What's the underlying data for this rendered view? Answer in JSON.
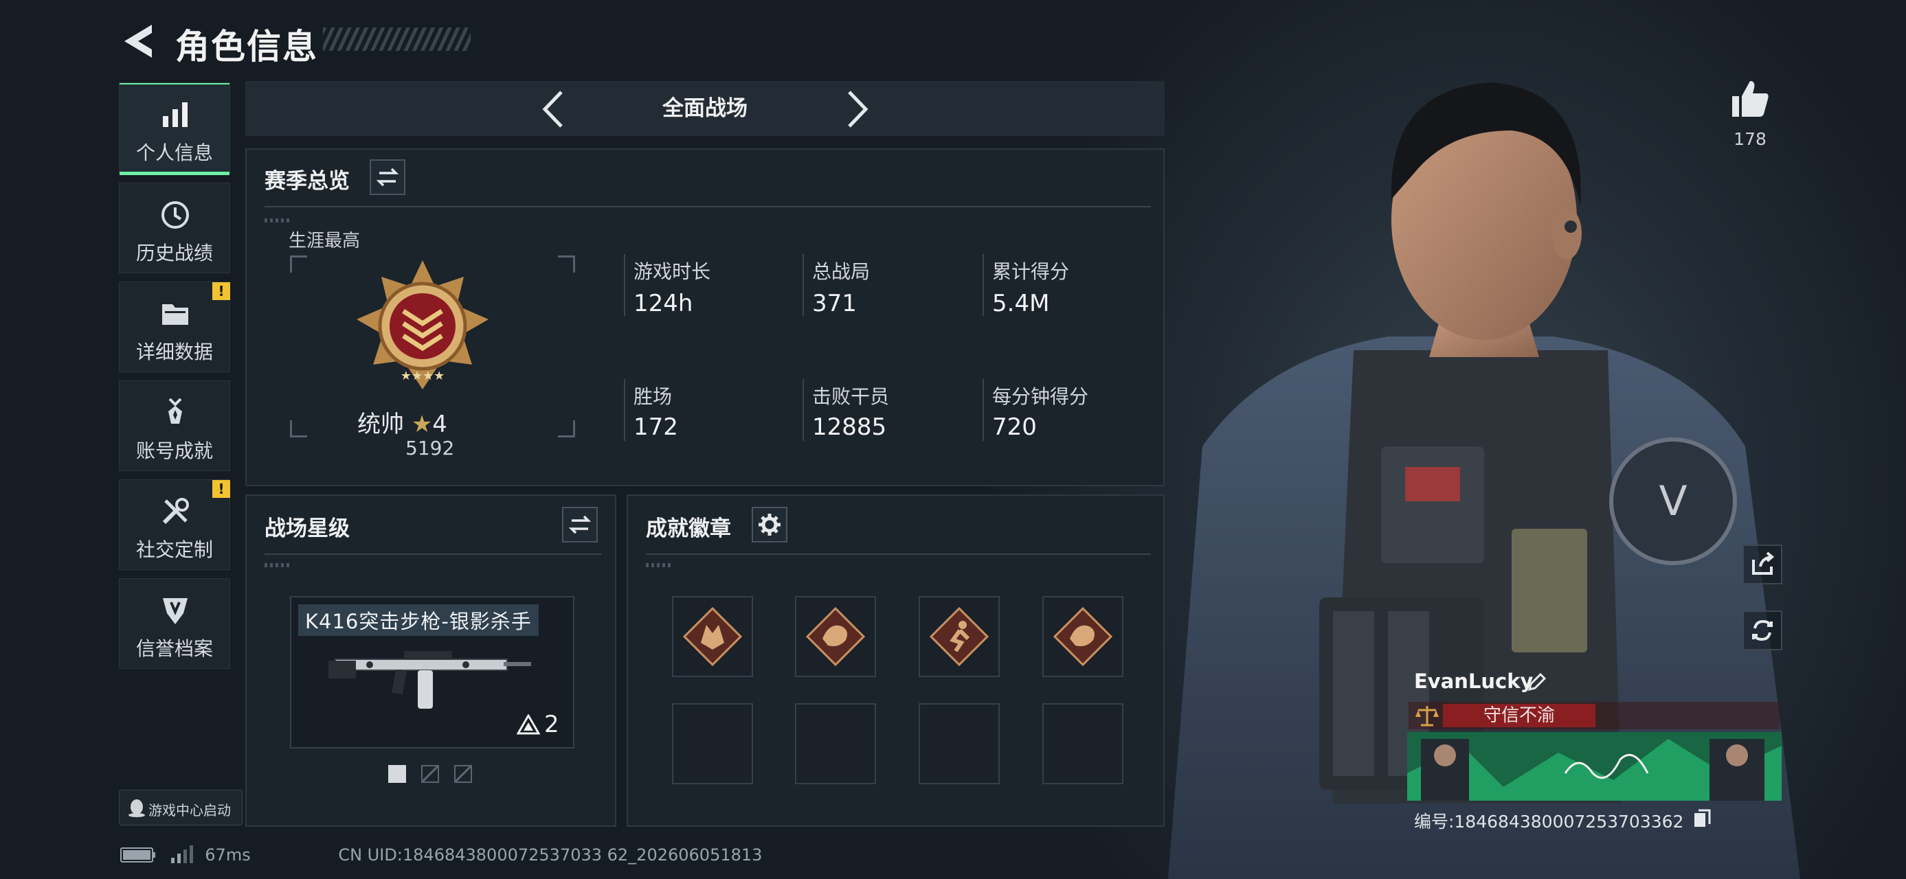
{
  "header": {
    "title": "角色信息"
  },
  "sidebar": {
    "items": [
      {
        "label": "个人信息",
        "icon": "bar-chart-icon",
        "active": true
      },
      {
        "label": "历史战绩",
        "icon": "history-clock-icon"
      },
      {
        "label": "详细数据",
        "icon": "folder-icon",
        "alert": "!"
      },
      {
        "label": "账号成就",
        "icon": "achievement-medal-icon"
      },
      {
        "label": "社交定制",
        "icon": "tools-icon",
        "alert": "!"
      },
      {
        "label": "信誉档案",
        "icon": "shield-emblem-icon"
      }
    ],
    "game_center_button": "游戏中心启动"
  },
  "mode_selector": {
    "title": "全面战场"
  },
  "season_overview": {
    "title": "赛季总览",
    "career_label": "生涯最高",
    "rank": {
      "name": "统帅",
      "stars": "4",
      "score": "5192"
    },
    "stats": [
      {
        "label": "游戏时长",
        "value": "124h"
      },
      {
        "label": "总战局",
        "value": "371"
      },
      {
        "label": "累计得分",
        "value": "5.4M"
      },
      {
        "label": "胜场",
        "value": "172"
      },
      {
        "label": "击败干员",
        "value": "12885"
      },
      {
        "label": "每分钟得分",
        "value": "720"
      }
    ]
  },
  "battlefield_stars": {
    "title": "战场星级",
    "weapon_name": "K416突击步枪-银影杀手",
    "weapon_star_level": "2",
    "page_count": 3,
    "active_page": 1
  },
  "achievement_badges": {
    "title": "成就徽章",
    "badges": [
      "wolf-badge-icon",
      "dragon-badge-icon",
      "runner-badge-icon",
      "dragon-badge-icon"
    ],
    "empty_slots": 4
  },
  "player": {
    "likes": "178",
    "name": "EvanLucky",
    "motto": "守信不渝",
    "id_text": "编号:1846843800072537033​62"
  },
  "status": {
    "ping": "67ms",
    "uid": "CN UID:1846843800072537033 62_202606051813"
  },
  "colors": {
    "accent": "#6df0a2",
    "alert": "#f2c230",
    "motto_red": "#8a1f22",
    "badge_gold": "#c89060"
  }
}
